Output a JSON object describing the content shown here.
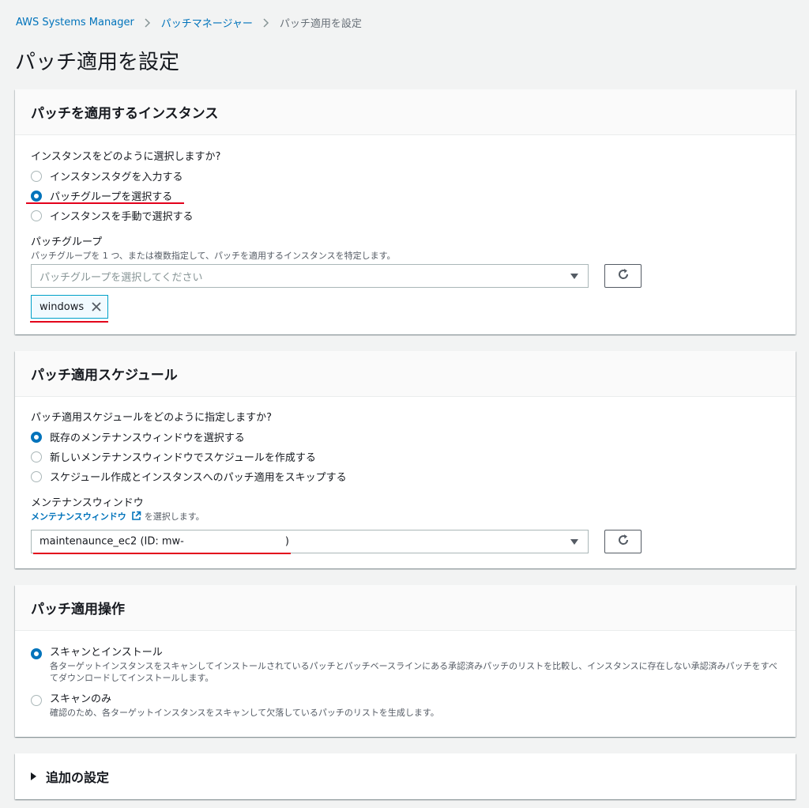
{
  "breadcrumb": {
    "items": [
      "AWS Systems Manager",
      "パッチマネージャー"
    ],
    "current": "パッチ適用を設定"
  },
  "page_title": "パッチ適用を設定",
  "instances_panel": {
    "title": "パッチを適用するインスタンス",
    "question": "インスタンスをどのように選択しますか?",
    "options": [
      "インスタンスタグを入力する",
      "パッチグループを選択する",
      "インスタンスを手動で選択する"
    ],
    "selected_index": 1,
    "patch_group_label": "パッチグループ",
    "patch_group_desc": "パッチグループを 1 つ、または複数指定して、パッチを適用するインスタンスを特定します。",
    "select_placeholder": "パッチグループを選択してください",
    "token": "windows"
  },
  "schedule_panel": {
    "title": "パッチ適用スケジュール",
    "question": "パッチ適用スケジュールをどのように指定しますか?",
    "options": [
      "既存のメンテナンスウィンドウを選択する",
      "新しいメンテナンスウィンドウでスケジュールを作成する",
      "スケジュール作成とインスタンスへのパッチ適用をスキップする"
    ],
    "selected_index": 0,
    "mw_label": "メンテナンスウィンドウ",
    "mw_link": "メンテナンスウィンドウ",
    "mw_desc_suffix": " を選択します。",
    "mw_value_prefix": "maintenaunce_ec2 (ID: mw-",
    "mw_value_suffix": ")"
  },
  "operation_panel": {
    "title": "パッチ適用操作",
    "options": [
      {
        "label": "スキャンとインストール",
        "desc": "各ターゲットインスタンスをスキャンしてインストールされているパッチとパッチベースラインにある承認済みパッチのリストを比較し、インスタンスに存在しない承認済みパッチをすべてダウンロードしてインストールします。"
      },
      {
        "label": "スキャンのみ",
        "desc": "確認のため、各ターゲットインスタンスをスキャンして欠落しているパッチのリストを生成します。"
      }
    ],
    "selected_index": 0
  },
  "additional_settings": {
    "label": "追加の設定"
  },
  "colors": {
    "link": "#0073bb",
    "radio_selected": "#0073bb",
    "annotation": "#e3001b"
  }
}
